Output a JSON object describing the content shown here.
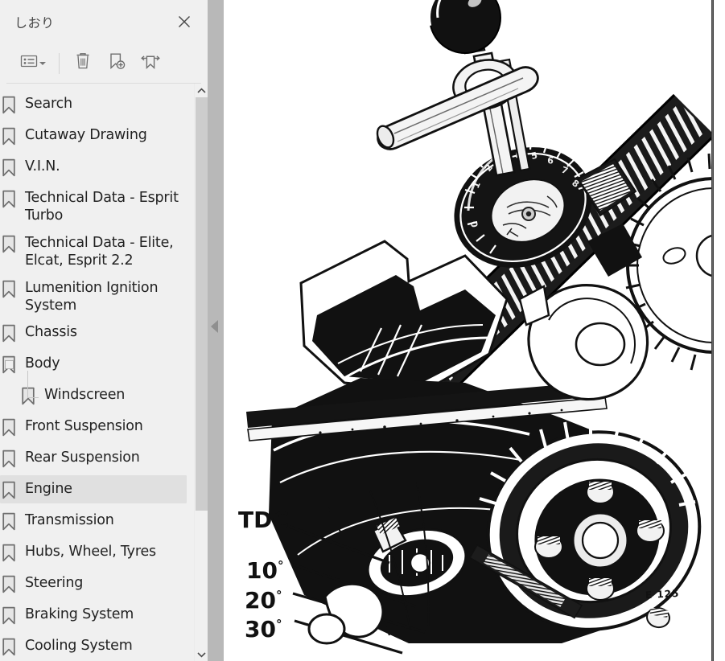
{
  "panel": {
    "title": "しおり",
    "close_icon": "close-icon",
    "toolbar": {
      "options_label": "options-list",
      "options_icon": "list-options-icon",
      "delete_icon": "trash-icon",
      "add_bookmark_icon": "add-bookmark-icon",
      "expand_collapse_icon": "expand-collapse-bookmark-icon"
    },
    "scrollbar": {
      "up_icon": "chevron-up-icon",
      "down_icon": "chevron-down-icon"
    },
    "bookmarks": [
      {
        "label": "Search",
        "level": 0,
        "selected": false,
        "expandable": false
      },
      {
        "label": "Cutaway Drawing",
        "level": 0,
        "selected": false,
        "expandable": false
      },
      {
        "label": "V.I.N.",
        "level": 0,
        "selected": false,
        "expandable": false
      },
      {
        "label": "Technical Data - Esprit Turbo",
        "level": 0,
        "selected": false,
        "expandable": false
      },
      {
        "label": "Technical Data - Elite, Elcat, Esprit 2.2",
        "level": 0,
        "selected": false,
        "expandable": false
      },
      {
        "label": "Lumenition Ignition System",
        "level": 0,
        "selected": false,
        "expandable": false
      },
      {
        "label": "Chassis",
        "level": 0,
        "selected": false,
        "expandable": false
      },
      {
        "label": "Body",
        "level": 0,
        "selected": false,
        "expandable": true
      },
      {
        "label": "Windscreen",
        "level": 1,
        "selected": false,
        "expandable": false
      },
      {
        "label": "Front Suspension",
        "level": 0,
        "selected": false,
        "expandable": false
      },
      {
        "label": "Rear Suspension",
        "level": 0,
        "selected": false,
        "expandable": false
      },
      {
        "label": "Engine",
        "level": 0,
        "selected": true,
        "expandable": false
      },
      {
        "label": "Transmission",
        "level": 0,
        "selected": false,
        "expandable": false
      },
      {
        "label": "Hubs, Wheel, Tyres",
        "level": 0,
        "selected": false,
        "expandable": false
      },
      {
        "label": "Steering",
        "level": 0,
        "selected": false,
        "expandable": false
      },
      {
        "label": "Braking System",
        "level": 0,
        "selected": false,
        "expandable": false
      },
      {
        "label": "Cooling System",
        "level": 0,
        "selected": false,
        "expandable": false
      }
    ]
  },
  "splitter": {
    "collapse_icon": "collapse-left-icon"
  },
  "document": {
    "illustration_name": "engine-timing-belt-tension-gauge-drawing",
    "annotations": [
      {
        "text": "TDC",
        "degree": ""
      },
      {
        "text": "10",
        "degree": "°"
      },
      {
        "text": "20",
        "degree": "°"
      },
      {
        "text": "30",
        "degree": "°"
      }
    ],
    "figure_ref": "E 125"
  },
  "colors": {
    "panel_bg": "#f0f0f0",
    "splitter_bg": "#b8b8b8",
    "selection_bg": "#e0e0e0",
    "icon_gray": "#808080",
    "text": "#222222",
    "page_bg": "#ffffff",
    "ink": "#111111"
  }
}
